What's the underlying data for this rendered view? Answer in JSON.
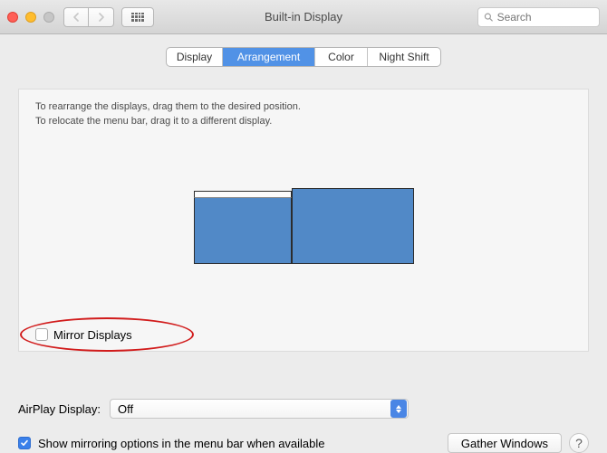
{
  "window": {
    "title": "Built-in Display"
  },
  "toolbar": {
    "search_placeholder": "Search"
  },
  "tabs": {
    "display": "Display",
    "arrangement": "Arrangement",
    "color": "Color",
    "night_shift": "Night Shift",
    "active": "arrangement"
  },
  "panel": {
    "hint_line1": "To rearrange the displays, drag them to the desired position.",
    "hint_line2": "To relocate the menu bar, drag it to a different display.",
    "mirror_label": "Mirror Displays",
    "mirror_checked": false
  },
  "airplay": {
    "label": "AirPlay Display:",
    "value": "Off"
  },
  "footer": {
    "show_mirroring_label": "Show mirroring options in the menu bar when available",
    "show_mirroring_checked": true,
    "gather_label": "Gather Windows"
  },
  "annotations": {
    "red_ellipse_on_mirror": true
  }
}
